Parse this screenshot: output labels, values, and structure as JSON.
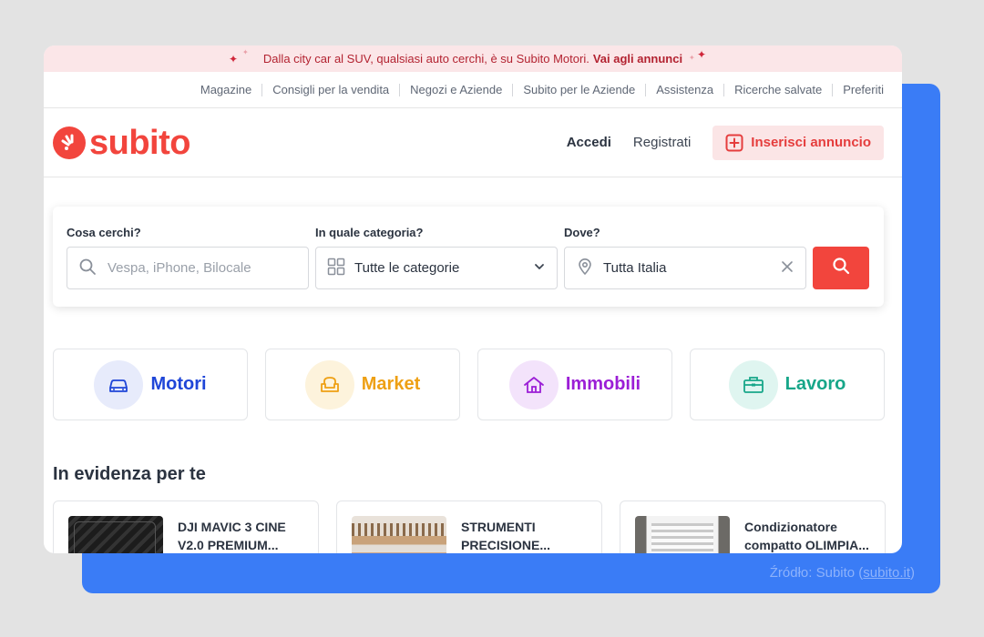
{
  "promo": {
    "text": "Dalla city car al SUV, qualsiasi auto cerchi, è su Subito Motori.",
    "link": "Vai agli annunci"
  },
  "topnav": [
    "Magazine",
    "Consigli per la vendita",
    "Negozi e Aziende",
    "Subito per le Aziende",
    "Assistenza",
    "Ricerche salvate",
    "Preferiti"
  ],
  "header": {
    "logo": "subito",
    "login": "Accedi",
    "register": "Registrati",
    "insert": "Inserisci annuncio"
  },
  "search": {
    "what_label": "Cosa cerchi?",
    "what_placeholder": "Vespa, iPhone, Bilocale",
    "category_label": "In quale categoria?",
    "category_value": "Tutte le categorie",
    "where_label": "Dove?",
    "where_value": "Tutta Italia"
  },
  "categories": [
    {
      "label": "Motori",
      "icon": "car-icon",
      "color": "#1f46d8",
      "bg": "#e7ebfb"
    },
    {
      "label": "Market",
      "icon": "armchair-icon",
      "color": "#eea014",
      "bg": "#fdf3dc"
    },
    {
      "label": "Immobili",
      "icon": "house-icon",
      "color": "#9b1ed6",
      "bg": "#f3e3fb"
    },
    {
      "label": "Lavoro",
      "icon": "briefcase-icon",
      "color": "#17a689",
      "bg": "#dff5f0"
    }
  ],
  "section_title": "In evidenza per te",
  "featured": [
    {
      "title": "DJI MAVIC 3 CINE V2.0 PREMIUM..."
    },
    {
      "title": "STRUMENTI PRECISIONE..."
    },
    {
      "title": "Condizionatore compatto OLIMPIA..."
    }
  ],
  "source": {
    "prefix": "Źródło: Subito (",
    "link": "subito.it",
    "suffix": ")"
  },
  "colors": {
    "brand": "#f2453d",
    "background_accent": "#3a7cf6"
  }
}
